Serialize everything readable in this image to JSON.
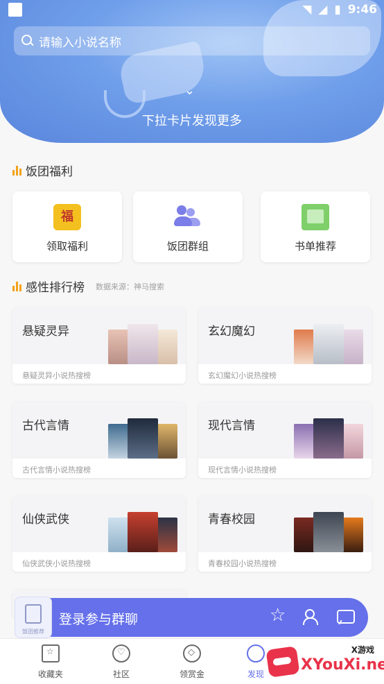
{
  "status_bar": {
    "time": "9:46"
  },
  "search": {
    "placeholder": "请输入小说名称"
  },
  "hero": {
    "pull_text": "下拉卡片发现更多"
  },
  "welfare": {
    "title": "饭团福利",
    "items": [
      {
        "label": "领取福利",
        "icon": "gift-icon"
      },
      {
        "label": "饭团群组",
        "icon": "group-icon"
      },
      {
        "label": "书单推荐",
        "icon": "booklist-icon"
      }
    ]
  },
  "ranking": {
    "title": "感性排行榜",
    "source": "数据来源：神马搜索",
    "cards": [
      {
        "name": "悬疑灵异",
        "sub": "悬疑灵异小说热搜榜"
      },
      {
        "name": "玄幻魔幻",
        "sub": "玄幻魔幻小说热搜榜"
      },
      {
        "name": "古代言情",
        "sub": "古代言情小说热搜榜"
      },
      {
        "name": "现代言情",
        "sub": "现代言情小说热搜榜"
      },
      {
        "name": "仙侠武侠",
        "sub": "仙侠武侠小说热搜榜"
      },
      {
        "name": "青春校园",
        "sub": "青春校园小说热搜榜"
      }
    ]
  },
  "login_bar": {
    "text": "登录参与群聊",
    "tag_label": "饭团推荐"
  },
  "bottom_nav": {
    "items": [
      {
        "label": "收藏夹"
      },
      {
        "label": "社区"
      },
      {
        "label": "领赏金"
      },
      {
        "label": "发现"
      }
    ]
  },
  "watermark": {
    "top": "X游戏",
    "main": "XYouXi.net"
  },
  "colors": {
    "accent": "#6570ea",
    "hero": "#6f9eea",
    "rank_bar": "#f3a21a"
  }
}
